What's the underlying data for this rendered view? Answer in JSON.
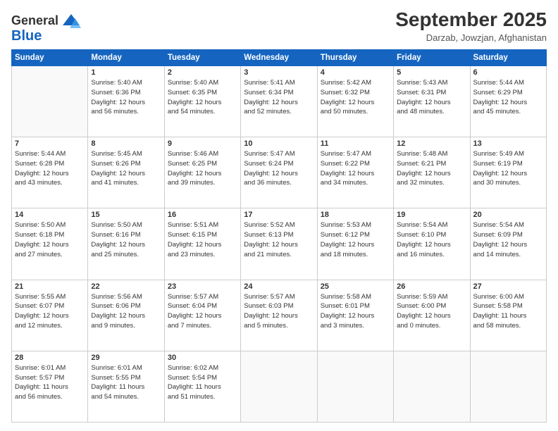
{
  "header": {
    "logo_line1": "General",
    "logo_line2": "Blue",
    "month": "September 2025",
    "location": "Darzab, Jowzjan, Afghanistan"
  },
  "days_of_week": [
    "Sunday",
    "Monday",
    "Tuesday",
    "Wednesday",
    "Thursday",
    "Friday",
    "Saturday"
  ],
  "weeks": [
    [
      {
        "day": "",
        "info": ""
      },
      {
        "day": "1",
        "info": "Sunrise: 5:40 AM\nSunset: 6:36 PM\nDaylight: 12 hours\nand 56 minutes."
      },
      {
        "day": "2",
        "info": "Sunrise: 5:40 AM\nSunset: 6:35 PM\nDaylight: 12 hours\nand 54 minutes."
      },
      {
        "day": "3",
        "info": "Sunrise: 5:41 AM\nSunset: 6:34 PM\nDaylight: 12 hours\nand 52 minutes."
      },
      {
        "day": "4",
        "info": "Sunrise: 5:42 AM\nSunset: 6:32 PM\nDaylight: 12 hours\nand 50 minutes."
      },
      {
        "day": "5",
        "info": "Sunrise: 5:43 AM\nSunset: 6:31 PM\nDaylight: 12 hours\nand 48 minutes."
      },
      {
        "day": "6",
        "info": "Sunrise: 5:44 AM\nSunset: 6:29 PM\nDaylight: 12 hours\nand 45 minutes."
      }
    ],
    [
      {
        "day": "7",
        "info": "Sunrise: 5:44 AM\nSunset: 6:28 PM\nDaylight: 12 hours\nand 43 minutes."
      },
      {
        "day": "8",
        "info": "Sunrise: 5:45 AM\nSunset: 6:26 PM\nDaylight: 12 hours\nand 41 minutes."
      },
      {
        "day": "9",
        "info": "Sunrise: 5:46 AM\nSunset: 6:25 PM\nDaylight: 12 hours\nand 39 minutes."
      },
      {
        "day": "10",
        "info": "Sunrise: 5:47 AM\nSunset: 6:24 PM\nDaylight: 12 hours\nand 36 minutes."
      },
      {
        "day": "11",
        "info": "Sunrise: 5:47 AM\nSunset: 6:22 PM\nDaylight: 12 hours\nand 34 minutes."
      },
      {
        "day": "12",
        "info": "Sunrise: 5:48 AM\nSunset: 6:21 PM\nDaylight: 12 hours\nand 32 minutes."
      },
      {
        "day": "13",
        "info": "Sunrise: 5:49 AM\nSunset: 6:19 PM\nDaylight: 12 hours\nand 30 minutes."
      }
    ],
    [
      {
        "day": "14",
        "info": "Sunrise: 5:50 AM\nSunset: 6:18 PM\nDaylight: 12 hours\nand 27 minutes."
      },
      {
        "day": "15",
        "info": "Sunrise: 5:50 AM\nSunset: 6:16 PM\nDaylight: 12 hours\nand 25 minutes."
      },
      {
        "day": "16",
        "info": "Sunrise: 5:51 AM\nSunset: 6:15 PM\nDaylight: 12 hours\nand 23 minutes."
      },
      {
        "day": "17",
        "info": "Sunrise: 5:52 AM\nSunset: 6:13 PM\nDaylight: 12 hours\nand 21 minutes."
      },
      {
        "day": "18",
        "info": "Sunrise: 5:53 AM\nSunset: 6:12 PM\nDaylight: 12 hours\nand 18 minutes."
      },
      {
        "day": "19",
        "info": "Sunrise: 5:54 AM\nSunset: 6:10 PM\nDaylight: 12 hours\nand 16 minutes."
      },
      {
        "day": "20",
        "info": "Sunrise: 5:54 AM\nSunset: 6:09 PM\nDaylight: 12 hours\nand 14 minutes."
      }
    ],
    [
      {
        "day": "21",
        "info": "Sunrise: 5:55 AM\nSunset: 6:07 PM\nDaylight: 12 hours\nand 12 minutes."
      },
      {
        "day": "22",
        "info": "Sunrise: 5:56 AM\nSunset: 6:06 PM\nDaylight: 12 hours\nand 9 minutes."
      },
      {
        "day": "23",
        "info": "Sunrise: 5:57 AM\nSunset: 6:04 PM\nDaylight: 12 hours\nand 7 minutes."
      },
      {
        "day": "24",
        "info": "Sunrise: 5:57 AM\nSunset: 6:03 PM\nDaylight: 12 hours\nand 5 minutes."
      },
      {
        "day": "25",
        "info": "Sunrise: 5:58 AM\nSunset: 6:01 PM\nDaylight: 12 hours\nand 3 minutes."
      },
      {
        "day": "26",
        "info": "Sunrise: 5:59 AM\nSunset: 6:00 PM\nDaylight: 12 hours\nand 0 minutes."
      },
      {
        "day": "27",
        "info": "Sunrise: 6:00 AM\nSunset: 5:58 PM\nDaylight: 11 hours\nand 58 minutes."
      }
    ],
    [
      {
        "day": "28",
        "info": "Sunrise: 6:01 AM\nSunset: 5:57 PM\nDaylight: 11 hours\nand 56 minutes."
      },
      {
        "day": "29",
        "info": "Sunrise: 6:01 AM\nSunset: 5:55 PM\nDaylight: 11 hours\nand 54 minutes."
      },
      {
        "day": "30",
        "info": "Sunrise: 6:02 AM\nSunset: 5:54 PM\nDaylight: 11 hours\nand 51 minutes."
      },
      {
        "day": "",
        "info": ""
      },
      {
        "day": "",
        "info": ""
      },
      {
        "day": "",
        "info": ""
      },
      {
        "day": "",
        "info": ""
      }
    ]
  ]
}
